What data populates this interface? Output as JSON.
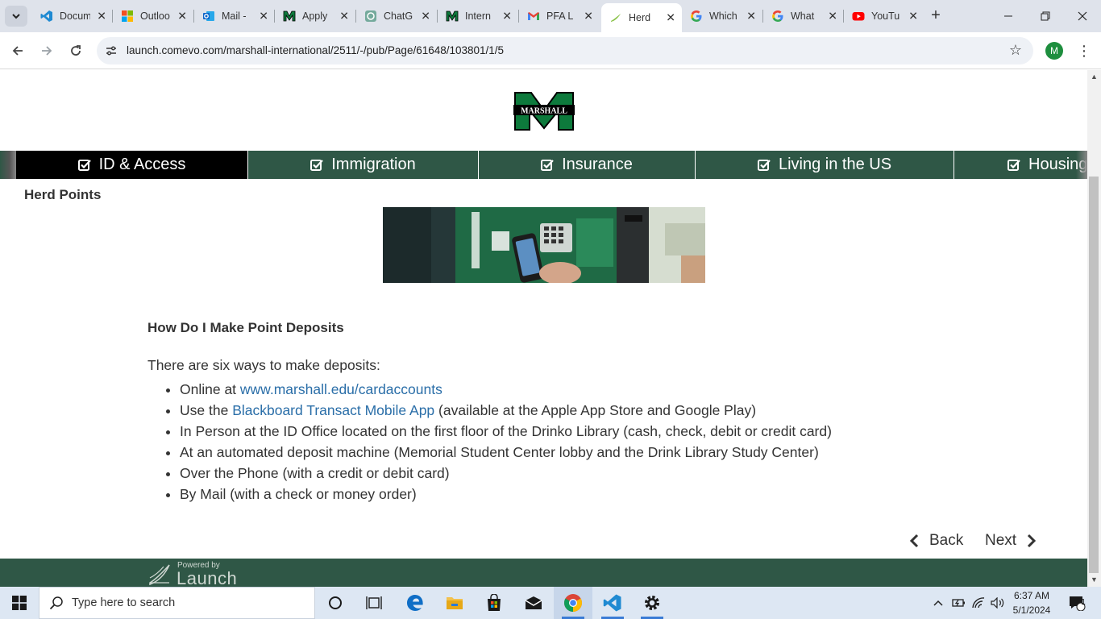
{
  "browser": {
    "tabs": [
      {
        "title": "Docum",
        "icon": "vscode-icon",
        "active": false
      },
      {
        "title": "Outloo",
        "icon": "microsoft-icon",
        "active": false
      },
      {
        "title": "Mail -",
        "icon": "outlook-icon",
        "active": false
      },
      {
        "title": "Apply",
        "icon": "marshall-icon",
        "active": false
      },
      {
        "title": "ChatG",
        "icon": "chatgpt-icon",
        "active": false
      },
      {
        "title": "Intern",
        "icon": "marshall-icon",
        "active": false
      },
      {
        "title": "PFA L",
        "icon": "gmail-icon",
        "active": false
      },
      {
        "title": "Herd",
        "icon": "launch-icon",
        "active": true
      },
      {
        "title": "Which",
        "icon": "google-icon",
        "active": false
      },
      {
        "title": "What",
        "icon": "google-icon",
        "active": false
      },
      {
        "title": "YouTu",
        "icon": "youtube-icon",
        "active": false
      }
    ],
    "url": "launch.comevo.com/marshall-international/2511/-/pub/Page/61648/103801/1/5",
    "profile_initial": "M"
  },
  "page": {
    "logo_text": "MARSHALL",
    "nav": [
      {
        "label": "ID & Access",
        "active": true
      },
      {
        "label": "Immigration",
        "active": false
      },
      {
        "label": "Insurance",
        "active": false
      },
      {
        "label": "Living in the US",
        "active": false
      },
      {
        "label": "Housing",
        "active": false
      }
    ],
    "section_title": "Herd Points",
    "heading": "How Do I Make Point Deposits",
    "intro": "There are six ways to make deposits:",
    "items": [
      {
        "pre": "Online at ",
        "link": "www.marshall.edu/cardaccounts",
        "post": ""
      },
      {
        "pre": "Use the ",
        "link": "Blackboard Transact Mobile App",
        "post": " (available at the Apple App Store and Google Play)"
      },
      {
        "pre": "In Person at the ID Office located on the first floor of the Drinko Library (cash, check, debit or credit card)",
        "link": "",
        "post": ""
      },
      {
        "pre": "At an automated deposit machine (Memorial Student Center lobby and the Drink Library Study Center)",
        "link": "",
        "post": ""
      },
      {
        "pre": "Over the Phone (with a credit or debit card)",
        "link": "",
        "post": ""
      },
      {
        "pre": "By Mail (with a check or money order)",
        "link": "",
        "post": ""
      }
    ],
    "back_label": "Back",
    "next_label": "Next",
    "footer": {
      "powered_by": "Powered by",
      "brand": "Launch"
    }
  },
  "taskbar": {
    "search_placeholder": "Type here to search",
    "time": "6:37 AM",
    "date": "5/1/2024",
    "notification_count": "1"
  },
  "colors": {
    "brand_green": "#2f5746",
    "link": "#2a6ea8",
    "active_nav": "#000000"
  }
}
